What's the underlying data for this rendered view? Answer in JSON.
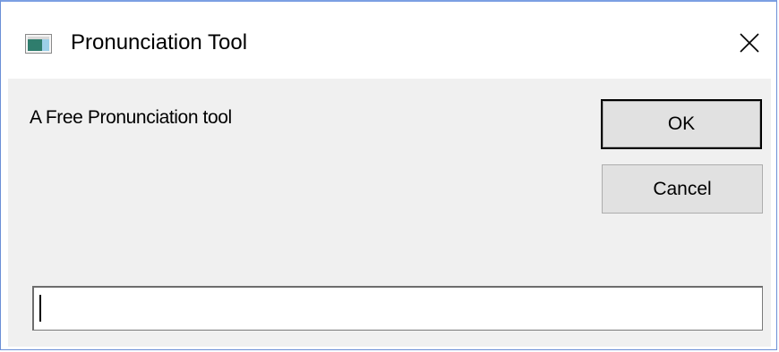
{
  "window": {
    "title": "Pronunciation Tool",
    "close_glyph": "✕",
    "app_icon": "app-window-icon",
    "close_icon": "close-icon"
  },
  "dialog": {
    "prompt": "A Free Pronunciation tool",
    "ok_label": "OK",
    "cancel_label": "Cancel",
    "input_value": ""
  },
  "colors": {
    "client_background": "#f0f0f0",
    "title_background": "#ffffff",
    "button_face": "#e1e1e1",
    "window_border": "#6b8fd6"
  }
}
